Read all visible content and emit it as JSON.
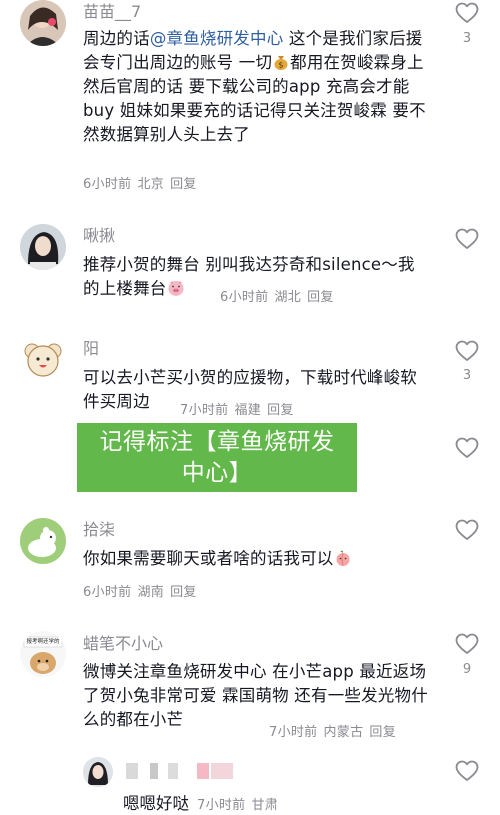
{
  "comments": [
    {
      "username": "苗苗__7",
      "text_before": "周边的话",
      "mention": "@章鱼烧研发中心",
      "text_after": " 这个是我们家后援会专门出周边的账号 一切",
      "text_after2": "都用在贺峻霖身上 然后官周的话 要下载公司的app 充高会才能buy 姐妹如果要充的话记得只关注贺峻霖 要不然数据算别人头上去了",
      "time": "6小时前",
      "location": "北京",
      "reply": "回复",
      "likes": "3"
    },
    {
      "username": "啾揪",
      "text": "推荐小贺的舞台 别叫我达芬奇和silence～我的上楼舞台",
      "time": "6小时前",
      "location": "湖北",
      "reply": "回复",
      "likes": ""
    },
    {
      "username": "阳",
      "text": "可以去小芒买小贺的应援物，下载时代峰峻软件买周边",
      "time": "7小时前",
      "location": "福建",
      "reply": "回复",
      "likes": "3"
    },
    {
      "username": "拾柒",
      "text": "你如果需要聊天或者啥的话我可以",
      "time": "6小时前",
      "location": "湖南",
      "reply": "回复",
      "likes": ""
    },
    {
      "username": "蜡笔不小心",
      "text": "微博关注章鱼烧研发中心 在小芒app 最近返场了贺小兔非常可爱 霖国萌物 还有一些发光物什么的都在小芒",
      "time": "7小时前",
      "location": "内蒙古",
      "reply": "回复",
      "likes": "9",
      "avatar_caption": "报考啊还学的"
    }
  ],
  "reply_item": {
    "text": "嗯嗯好哒",
    "time": "7小时前",
    "location": "甘肃"
  },
  "banner": {
    "line1": "记得标注【章鱼烧研发",
    "line2": "中心】"
  },
  "icons": {
    "like": "heart-outline-icon",
    "money": "money-bag-emoji",
    "pig": "pig-face-emoji",
    "peach": "peach-emoji"
  },
  "colors": {
    "banner": "#62b84a",
    "mention": "#2f5fa3",
    "meta": "#8a8b91"
  }
}
